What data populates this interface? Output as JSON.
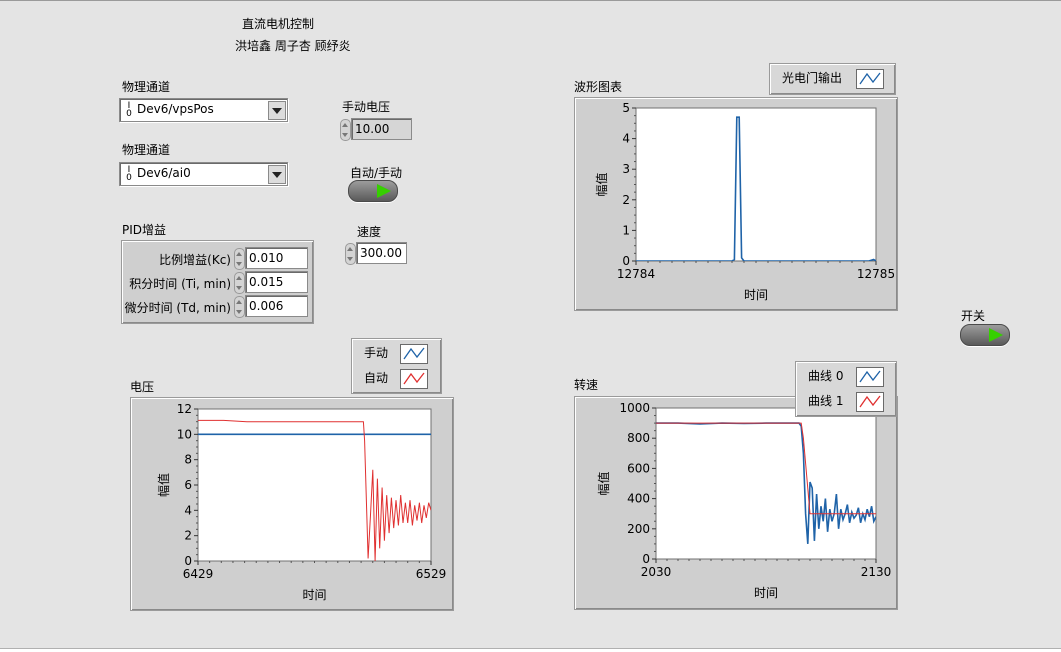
{
  "header": {
    "title": "直流电机控制",
    "authors": "洪培鑫 周子杏 顾纾炎"
  },
  "channel1": {
    "label": "物理通道",
    "value": "Dev6/vpsPos",
    "io_glyph": "I/O"
  },
  "channel2": {
    "label": "物理通道",
    "value": "Dev6/ai0",
    "io_glyph": "I/O"
  },
  "manual_voltage": {
    "label": "手动电压",
    "value": "10.00"
  },
  "auto_manual": {
    "label": "自动/手动"
  },
  "speed": {
    "label": "速度",
    "value": "300.00"
  },
  "pid": {
    "label": "PID增益",
    "kc": {
      "label": "比例增益(Kc)",
      "value": "0.010"
    },
    "ti": {
      "label": "积分时间 (Ti, min)",
      "value": "0.015"
    },
    "td": {
      "label": "微分时间 (Td, min)",
      "value": "0.006"
    }
  },
  "switch": {
    "label": "开关"
  },
  "colors": {
    "blue_series": "#1f63a8",
    "red_series": "#e03030",
    "led_green": "#36d000",
    "background": "#e4e4e4"
  },
  "waveform": {
    "label": "波形图表",
    "legend": [
      {
        "name": "光电门输出",
        "color": "#1f63a8"
      }
    ]
  },
  "voltage": {
    "label": "电压",
    "legend": [
      {
        "name": "手动",
        "color": "#1f63a8"
      },
      {
        "name": "自动",
        "color": "#e03030"
      }
    ]
  },
  "rpm": {
    "label": "转速",
    "legend": [
      {
        "name": "曲线 0",
        "color": "#1f63a8"
      },
      {
        "name": "曲线 1",
        "color": "#e03030"
      }
    ]
  },
  "chart_data": [
    {
      "id": "waveform",
      "type": "line",
      "xlabel": "时间",
      "ylabel": "幅值",
      "xlim": [
        12784,
        12785
      ],
      "ylim": [
        0,
        5
      ],
      "xticks": [
        "12784",
        "12785"
      ],
      "yticks": [
        "0",
        "1",
        "2",
        "3",
        "4",
        "5"
      ],
      "series": [
        {
          "name": "光电门输出",
          "x": [
            12784,
            12784.35,
            12784.4,
            12784.41,
            12784.42,
            12784.43,
            12784.44,
            12784.45,
            12784.97,
            12784.99,
            12785
          ],
          "y": [
            0,
            0,
            0,
            0.05,
            4.7,
            4.7,
            0.1,
            0,
            0,
            0.05,
            0
          ]
        }
      ]
    },
    {
      "id": "voltage",
      "type": "line",
      "xlabel": "时间",
      "ylabel": "幅值",
      "xlim": [
        6429,
        6529
      ],
      "ylim": [
        0,
        12
      ],
      "xticks": [
        "6429",
        "6529"
      ],
      "yticks": [
        "0",
        "2",
        "4",
        "6",
        "8",
        "10",
        "12"
      ],
      "series": [
        {
          "name": "手动",
          "x": [
            6429,
            6529
          ],
          "y": [
            10,
            10
          ]
        },
        {
          "name": "自动",
          "x": [
            6429,
            6440,
            6450,
            6470,
            6490,
            6500,
            6500.5,
            6502,
            6503,
            6504,
            6505,
            6506,
            6507,
            6508,
            6509,
            6510,
            6511,
            6512,
            6513,
            6514,
            6515,
            6516,
            6517,
            6518,
            6519,
            6520,
            6521,
            6522,
            6523,
            6524,
            6525,
            6526,
            6527,
            6528,
            6529
          ],
          "y": [
            11.1,
            11.1,
            11.0,
            11.0,
            11.0,
            11.0,
            9.5,
            0.2,
            3.5,
            7.2,
            0.0,
            6.5,
            1.0,
            5.8,
            1.6,
            5.2,
            2.2,
            5.0,
            2.6,
            4.8,
            2.8,
            5.2,
            3.0,
            4.6,
            3.0,
            4.8,
            2.8,
            4.4,
            3.2,
            4.6,
            3.0,
            4.4,
            3.4,
            4.6,
            4.0
          ]
        }
      ]
    },
    {
      "id": "rpm",
      "type": "line",
      "xlabel": "时间",
      "ylabel": "幅值",
      "xlim": [
        2030,
        2130
      ],
      "ylim": [
        0,
        1000
      ],
      "xticks": [
        "2030",
        "2130"
      ],
      "yticks": [
        "0",
        "200",
        "400",
        "600",
        "800",
        "1000"
      ],
      "series": [
        {
          "name": "曲线 0",
          "x": [
            2030,
            2040,
            2050,
            2060,
            2070,
            2080,
            2095,
            2096,
            2097,
            2098,
            2099,
            2100,
            2101,
            2102,
            2103,
            2104,
            2105,
            2106,
            2107,
            2108,
            2109,
            2110,
            2111,
            2112,
            2113,
            2114,
            2115,
            2116,
            2117,
            2118,
            2119,
            2120,
            2121,
            2122,
            2123,
            2124,
            2125,
            2126,
            2127,
            2128,
            2129,
            2130
          ],
          "y": [
            900,
            900,
            895,
            900,
            898,
            900,
            900,
            880,
            700,
            300,
            100,
            510,
            470,
            120,
            430,
            200,
            350,
            250,
            400,
            180,
            330,
            250,
            300,
            430,
            200,
            330,
            260,
            300,
            360,
            240,
            310,
            270,
            290,
            340,
            240,
            300,
            260,
            330,
            280,
            350,
            250,
            280
          ]
        },
        {
          "name": "曲线 1",
          "x": [
            2030,
            2096,
            2097,
            2100,
            2101,
            2130
          ],
          "y": [
            900,
            900,
            800,
            300,
            300,
            300
          ]
        }
      ]
    }
  ]
}
